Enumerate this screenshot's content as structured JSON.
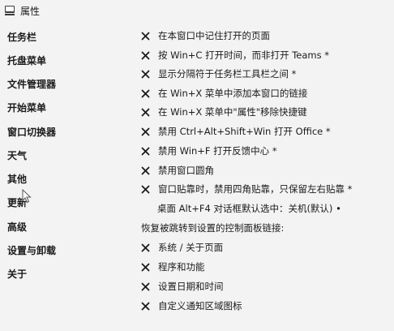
{
  "window": {
    "title": "属性",
    "icon": "app-window-icon"
  },
  "sidebar": {
    "items": [
      {
        "label": "任务栏"
      },
      {
        "label": "托盘菜单"
      },
      {
        "label": "文件管理器"
      },
      {
        "label": "开始菜单"
      },
      {
        "label": "窗口切换器"
      },
      {
        "label": "天气"
      },
      {
        "label": "其他"
      },
      {
        "label": "更新"
      },
      {
        "label": "高级"
      },
      {
        "label": "设置与卸载"
      },
      {
        "label": "关于"
      }
    ]
  },
  "main": {
    "options": [
      {
        "label": "在本窗口中记住打开的页面",
        "state_icon": "x-icon"
      },
      {
        "label": "按 Win+C 打开时间，而非打开 Teams *",
        "state_icon": "x-icon"
      },
      {
        "label": "显示分隔符于任务栏工具栏之间 *",
        "state_icon": "x-icon"
      },
      {
        "label": "在 Win+X 菜单中添加本窗口的链接",
        "state_icon": "x-icon"
      },
      {
        "label": "在 Win+X 菜单中\"属性\"移除快捷键",
        "state_icon": "x-icon"
      },
      {
        "label": "禁用 Ctrl+Alt+Shift+Win 打开 Office *",
        "state_icon": "x-icon"
      },
      {
        "label": "禁用 Win+F 打开反馈中心 *",
        "state_icon": "x-icon"
      },
      {
        "label": "禁用窗口圆角",
        "state_icon": "x-icon"
      },
      {
        "label": "窗口贴靠时，禁用四角贴靠，只保留左右贴靠 *",
        "state_icon": "x-icon"
      }
    ],
    "alt_f4_setting": {
      "text": "桌面 Alt+F4 对话框默认选中：关机(默认) •"
    },
    "restore_section": {
      "heading": "恢复被跳转到设置的控制面板链接:"
    },
    "restore_options": [
      {
        "label": "系统 / 关于页面",
        "state_icon": "x-icon"
      },
      {
        "label": "程序和功能",
        "state_icon": "x-icon"
      },
      {
        "label": "设置日期和时间",
        "state_icon": "x-icon"
      },
      {
        "label": "自定义通知区域图标",
        "state_icon": "x-icon"
      }
    ]
  }
}
